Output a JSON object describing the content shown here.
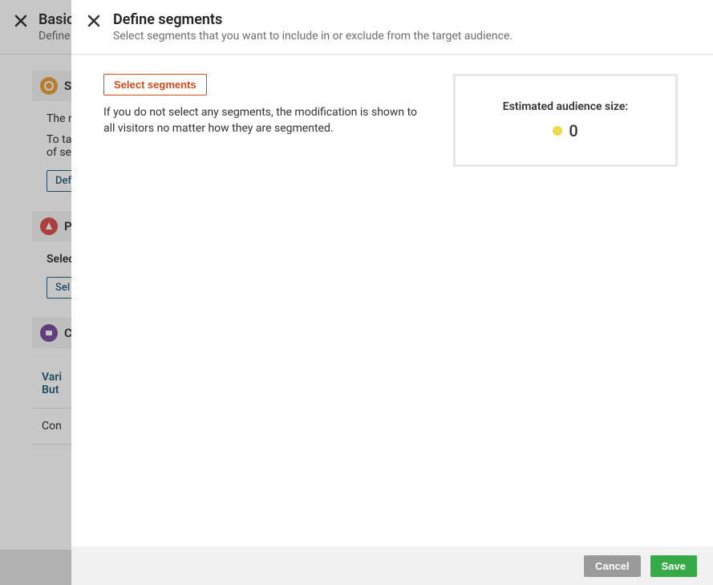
{
  "background": {
    "title": "Basic s",
    "subtitle": "Define th",
    "section1": {
      "title": "Se",
      "text1": "The n",
      "text2": "To ta",
      "text3": "of seg",
      "button": "Def"
    },
    "section2": {
      "title": "Pla",
      "label": "Selec",
      "button": "Sel"
    },
    "section3": {
      "title": "Co",
      "variant1": "Vari",
      "variant2": "But",
      "con": "Con"
    }
  },
  "modal": {
    "title": "Define segments",
    "subtitle": "Select segments that you want to include in or exclude from the target audience.",
    "select_button": "Select segments",
    "hint": "If you do not select any segments, the modification is shown to all visitors no matter how they are segmented.",
    "audience_label": "Estimated audience size:",
    "audience_value": "0",
    "cancel": "Cancel",
    "save": "Save"
  }
}
